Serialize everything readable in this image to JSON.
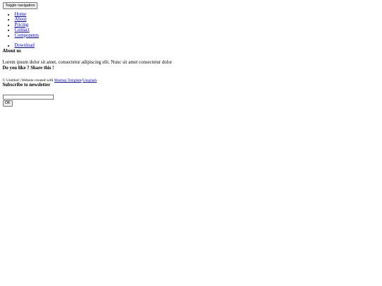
{
  "header": {
    "toggle_label": "Toggle navigation"
  },
  "nav": {
    "items": [
      {
        "label": "Home"
      },
      {
        "label": "About"
      },
      {
        "label": "Pricing"
      },
      {
        "label": "Contact"
      },
      {
        "label": "Components"
      }
    ],
    "right_items": [
      {
        "label": "Download"
      }
    ]
  },
  "about": {
    "title": "About us",
    "text": "Lorem ipsum dolor sit amet, consectetur adipiscing elit. Nunc sit amet consectetur dolor"
  },
  "share": {
    "title": "Do you like ? Share this !"
  },
  "footer": {
    "credits_prefix": "© Untitled | Website created with ",
    "credits_link1": "Mashup Template",
    "credits_sep": "/",
    "credits_link2": "Unsplash"
  },
  "newsletter": {
    "title": "Subscribe to newsletter",
    "input_value": "",
    "button_label": "OK"
  }
}
